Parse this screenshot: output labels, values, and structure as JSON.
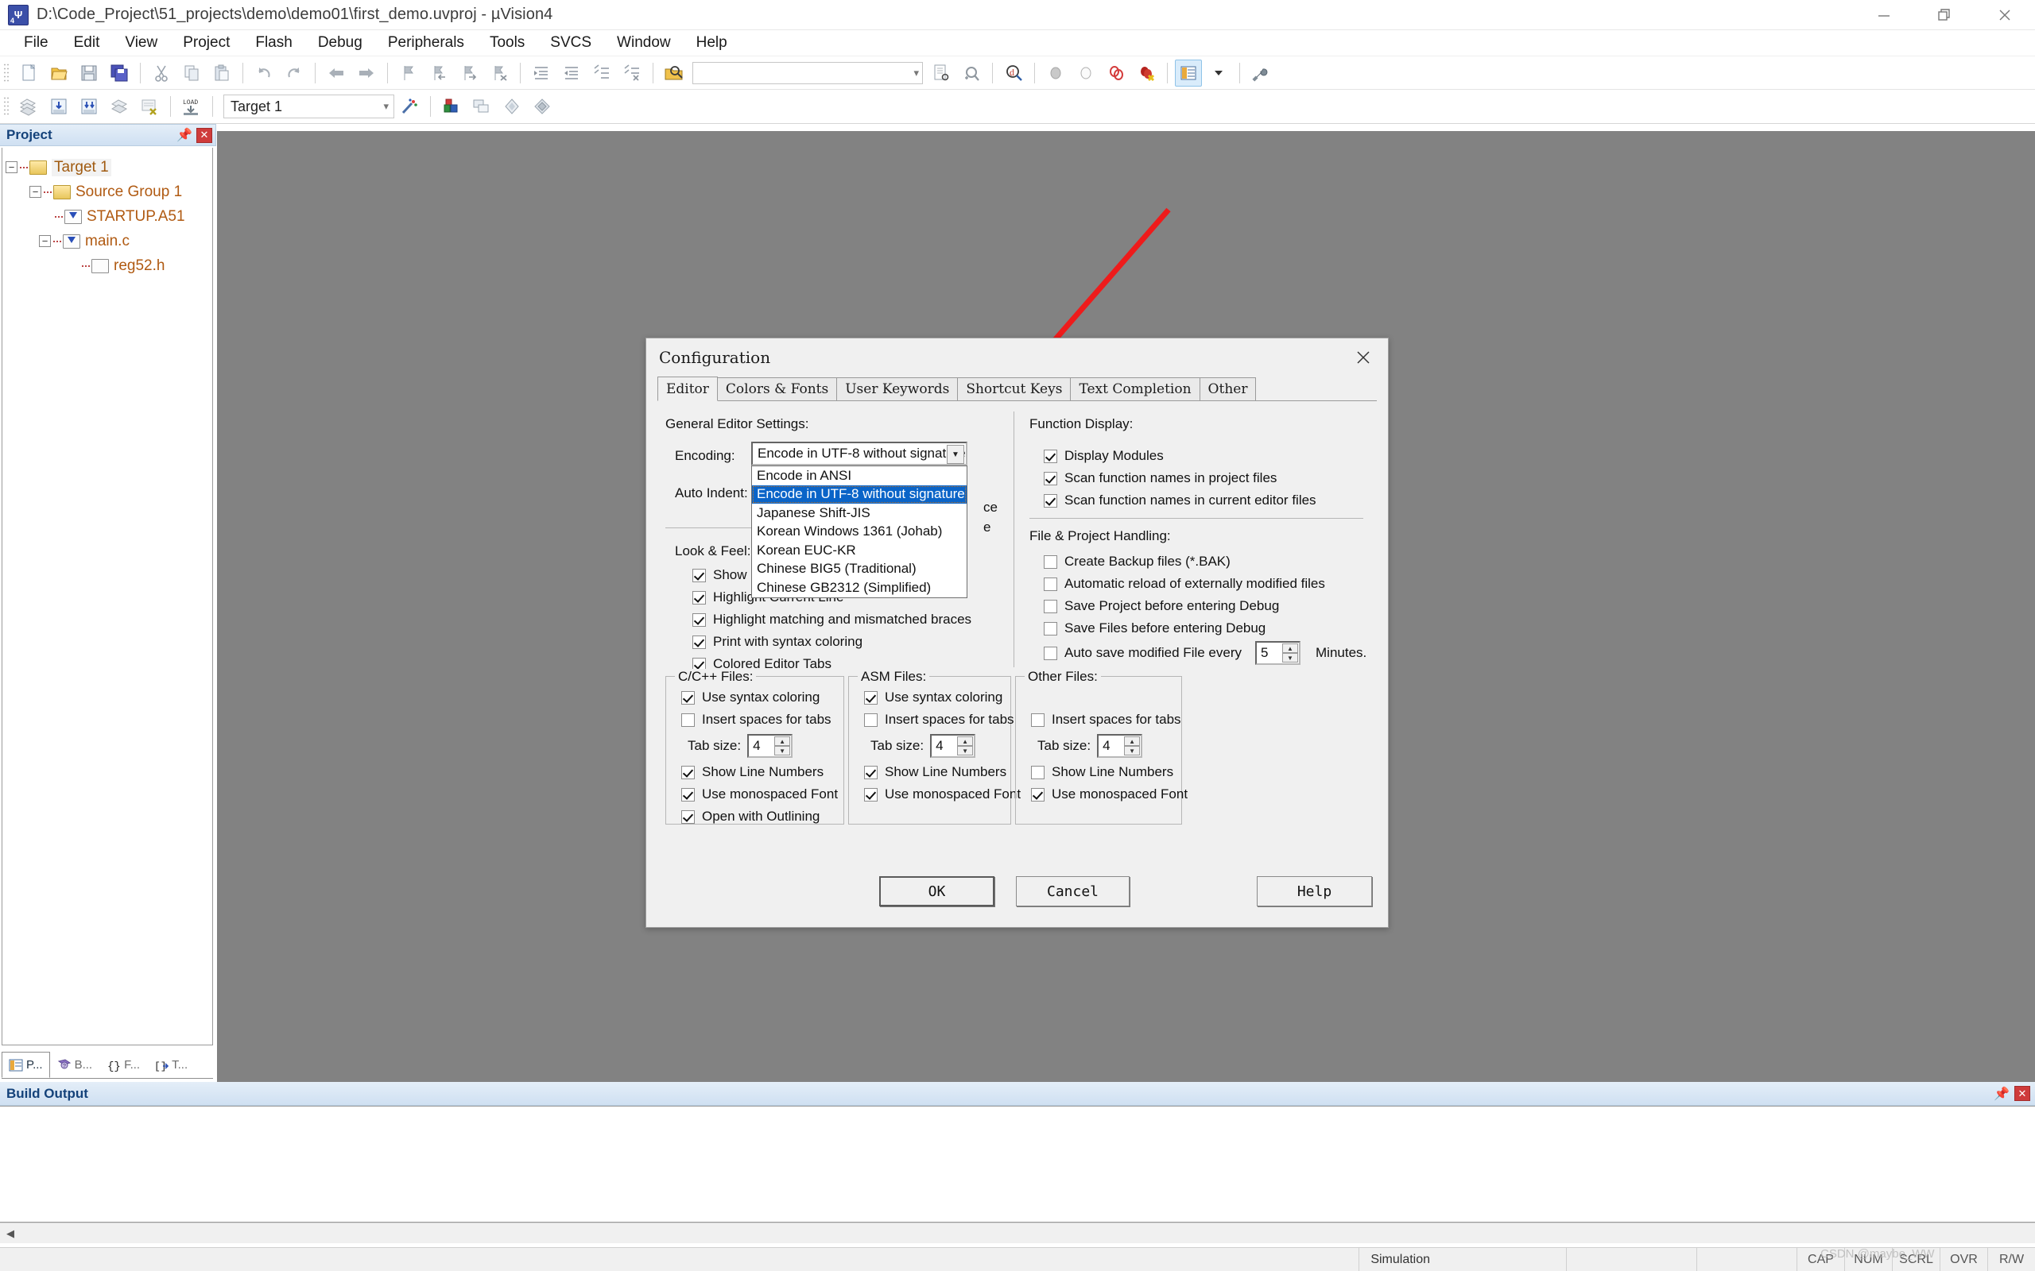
{
  "window": {
    "title": "D:\\Code_Project\\51_projects\\demo\\demo01\\first_demo.uvproj - µVision4",
    "app_icon": "uvision-logo-icon",
    "controls": {
      "minimize": "minimize-icon",
      "maximize": "maximize-icon",
      "close": "close-icon"
    }
  },
  "menubar": {
    "items": [
      "File",
      "Edit",
      "View",
      "Project",
      "Flash",
      "Debug",
      "Peripherals",
      "Tools",
      "SVCS",
      "Window",
      "Help"
    ]
  },
  "toolbar_main": {
    "search_placeholder": "",
    "search_value": "",
    "icons": [
      "new-file-icon",
      "open-file-icon",
      "save-icon",
      "save-all-icon",
      "cut-icon",
      "copy-icon",
      "paste-icon",
      "undo-icon",
      "redo-icon",
      "navigate-back-icon",
      "navigate-forward-icon",
      "bookmark-toggle-icon",
      "bookmark-prev-icon",
      "bookmark-next-icon",
      "bookmark-clear-icon",
      "indent-icon",
      "outdent-icon",
      "comment-icon",
      "uncomment-icon",
      "find-in-files-icon",
      "incremental-find-icon",
      "debug-find-icon",
      "insert-breakpoint-icon",
      "enable-breakpoint-icon",
      "disable-all-breakpoints-icon",
      "kill-all-breakpoints-icon",
      "project-window-icon",
      "chevron-down-icon",
      "configuration-icon"
    ]
  },
  "toolbar_build": {
    "target_value": "Target 1",
    "icons": [
      "translate-icon",
      "build-target-icon",
      "rebuild-all-icon",
      "batch-build-icon",
      "stop-build-icon",
      "download-icon",
      "target-options-icon",
      "manage-components-icon",
      "multi-project-icon",
      "book-icon",
      "components-icon"
    ]
  },
  "project_panel": {
    "title": "Project",
    "pin_icon": "pin-icon",
    "close_icon": "close-icon",
    "tree": [
      {
        "label": "Target 1",
        "icon": "target-folder-icon",
        "level": 0,
        "expander": "minus",
        "selected": true
      },
      {
        "label": "Source Group 1",
        "icon": "folder-icon",
        "level": 1,
        "expander": "minus",
        "selected": false
      },
      {
        "label": "STARTUP.A51",
        "icon": "asm-file-icon",
        "level": 2,
        "expander": "none",
        "selected": false
      },
      {
        "label": "main.c",
        "icon": "c-file-icon",
        "level": 2,
        "expander": "minus",
        "selected": false
      },
      {
        "label": "reg52.h",
        "icon": "header-file-icon",
        "level": 3,
        "expander": "none",
        "selected": false
      }
    ],
    "tabs": [
      {
        "label": "P...",
        "icon": "project-icon",
        "active": true
      },
      {
        "label": "B...",
        "icon": "books-icon",
        "active": false
      },
      {
        "label": "F...",
        "icon": "functions-icon",
        "active": false
      },
      {
        "label": "T...",
        "icon": "templates-icon",
        "active": false
      }
    ]
  },
  "build_output": {
    "title": "Build Output",
    "pin_icon": "pin-icon",
    "close_icon": "close-icon",
    "content": ""
  },
  "statusbar": {
    "message": "",
    "mode": "Simulation",
    "indicators": [
      "CAP",
      "NUM",
      "SCRL",
      "OVR",
      "R/W"
    ],
    "watermark": "CSDN @maybe_WW"
  },
  "dialog": {
    "title": "Configuration",
    "close_icon": "close-icon",
    "tabs": [
      {
        "label": "Editor",
        "active": true
      },
      {
        "label": "Colors & Fonts",
        "active": false
      },
      {
        "label": "User Keywords",
        "active": false
      },
      {
        "label": "Shortcut Keys",
        "active": false
      },
      {
        "label": "Text Completion",
        "active": false
      },
      {
        "label": "Other",
        "active": false
      }
    ],
    "general": {
      "section_title": "General Editor Settings:",
      "encoding_label": "Encoding:",
      "encoding_value": "Encode in UTF-8 without signature",
      "auto_indent_label": "Auto Indent:",
      "look_feel_label": "Look & Feel:",
      "hidden_text_1": "ce",
      "hidden_text_2": "e",
      "encoding_options": [
        {
          "label": "Encode in ANSI",
          "selected": false
        },
        {
          "label": "Encode in UTF-8 without signature",
          "selected": true
        },
        {
          "label": "Japanese Shift-JIS",
          "selected": false
        },
        {
          "label": "Korean Windows 1361 (Johab)",
          "selected": false
        },
        {
          "label": "Korean EUC-KR",
          "selected": false
        },
        {
          "label": "Chinese BIG5 (Traditional)",
          "selected": false
        },
        {
          "label": "Chinese GB2312 (Simplified)",
          "selected": false
        }
      ],
      "look_feel_options": [
        {
          "label": "Show Message Dialog during Find",
          "checked": true
        },
        {
          "label": "Highlight Current Line",
          "checked": true
        },
        {
          "label": "Highlight matching and mismatched braces",
          "checked": true
        },
        {
          "label": "Print with syntax coloring",
          "checked": true
        },
        {
          "label": "Colored Editor Tabs",
          "checked": true
        }
      ]
    },
    "function_display": {
      "section_title": "Function Display:",
      "options": [
        {
          "label": "Display Modules",
          "checked": true
        },
        {
          "label": "Scan function names in project files",
          "checked": true
        },
        {
          "label": "Scan function names in current editor files",
          "checked": true
        }
      ]
    },
    "file_project": {
      "section_title": "File & Project Handling:",
      "options": [
        {
          "label": "Create Backup files (*.BAK)",
          "checked": false
        },
        {
          "label": "Automatic reload of externally modified files",
          "checked": false
        },
        {
          "label": "Save Project before entering Debug",
          "checked": false
        },
        {
          "label": "Save Files before entering Debug",
          "checked": false
        }
      ],
      "autosave_label": "Auto save modified File every",
      "autosave_checked": false,
      "autosave_value": "5",
      "autosave_suffix": "Minutes."
    },
    "c_files": {
      "section_title": "C/C++ Files:",
      "options_top": [
        {
          "label": "Use syntax coloring",
          "checked": true
        },
        {
          "label": "Insert spaces for tabs",
          "checked": false
        }
      ],
      "tab_size_label": "Tab size:",
      "tab_size_value": "4",
      "options_bottom": [
        {
          "label": "Show Line Numbers",
          "checked": true
        },
        {
          "label": "Use monospaced Font",
          "checked": true
        },
        {
          "label": "Open with Outlining",
          "checked": true
        }
      ]
    },
    "asm_files": {
      "section_title": "ASM Files:",
      "options_top": [
        {
          "label": "Use syntax coloring",
          "checked": true
        },
        {
          "label": "Insert spaces for tabs",
          "checked": false
        }
      ],
      "tab_size_label": "Tab size:",
      "tab_size_value": "4",
      "options_bottom": [
        {
          "label": "Show Line Numbers",
          "checked": true
        },
        {
          "label": "Use monospaced Font",
          "checked": true
        }
      ]
    },
    "other_files": {
      "section_title": "Other Files:",
      "options_top": [
        {
          "label": "Insert spaces for tabs",
          "checked": false
        }
      ],
      "tab_size_label": "Tab size:",
      "tab_size_value": "4",
      "options_bottom": [
        {
          "label": "Show Line Numbers",
          "checked": false
        },
        {
          "label": "Use monospaced Font",
          "checked": true
        }
      ]
    },
    "buttons": {
      "ok": "OK",
      "cancel": "Cancel",
      "help": "Help"
    }
  },
  "annotation": {
    "arrow_color": "#ee1b1b",
    "name": "red-pointer-arrow"
  }
}
